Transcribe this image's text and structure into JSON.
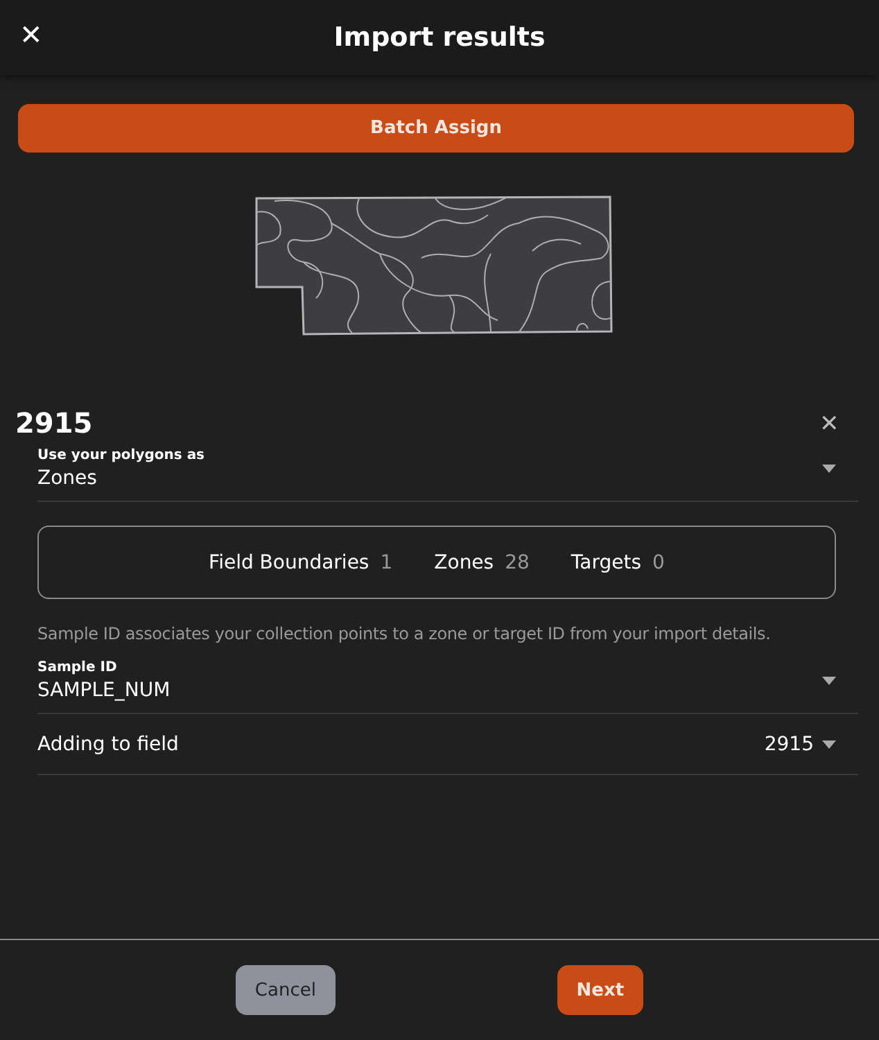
{
  "header": {
    "close": "✕",
    "title": "Import results"
  },
  "batch_button": "Batch Assign",
  "field": {
    "name": "2915",
    "close": "✕"
  },
  "polygons_select": {
    "label": "Use your polygons as",
    "value": "Zones"
  },
  "counts": [
    {
      "label": "Field Boundaries",
      "value": "1"
    },
    {
      "label": "Zones",
      "value": "28"
    },
    {
      "label": "Targets",
      "value": "0"
    }
  ],
  "hint": "Sample ID associates your collection points to a zone or target ID from your import details.",
  "sample_select": {
    "label": "Sample ID",
    "value": "SAMPLE_NUM"
  },
  "adding": {
    "label": "Adding to field",
    "value": "2915"
  },
  "buttons": [
    {
      "label": "Cancel",
      "kind": "secondary"
    },
    {
      "label": "Next",
      "kind": "primary"
    }
  ]
}
